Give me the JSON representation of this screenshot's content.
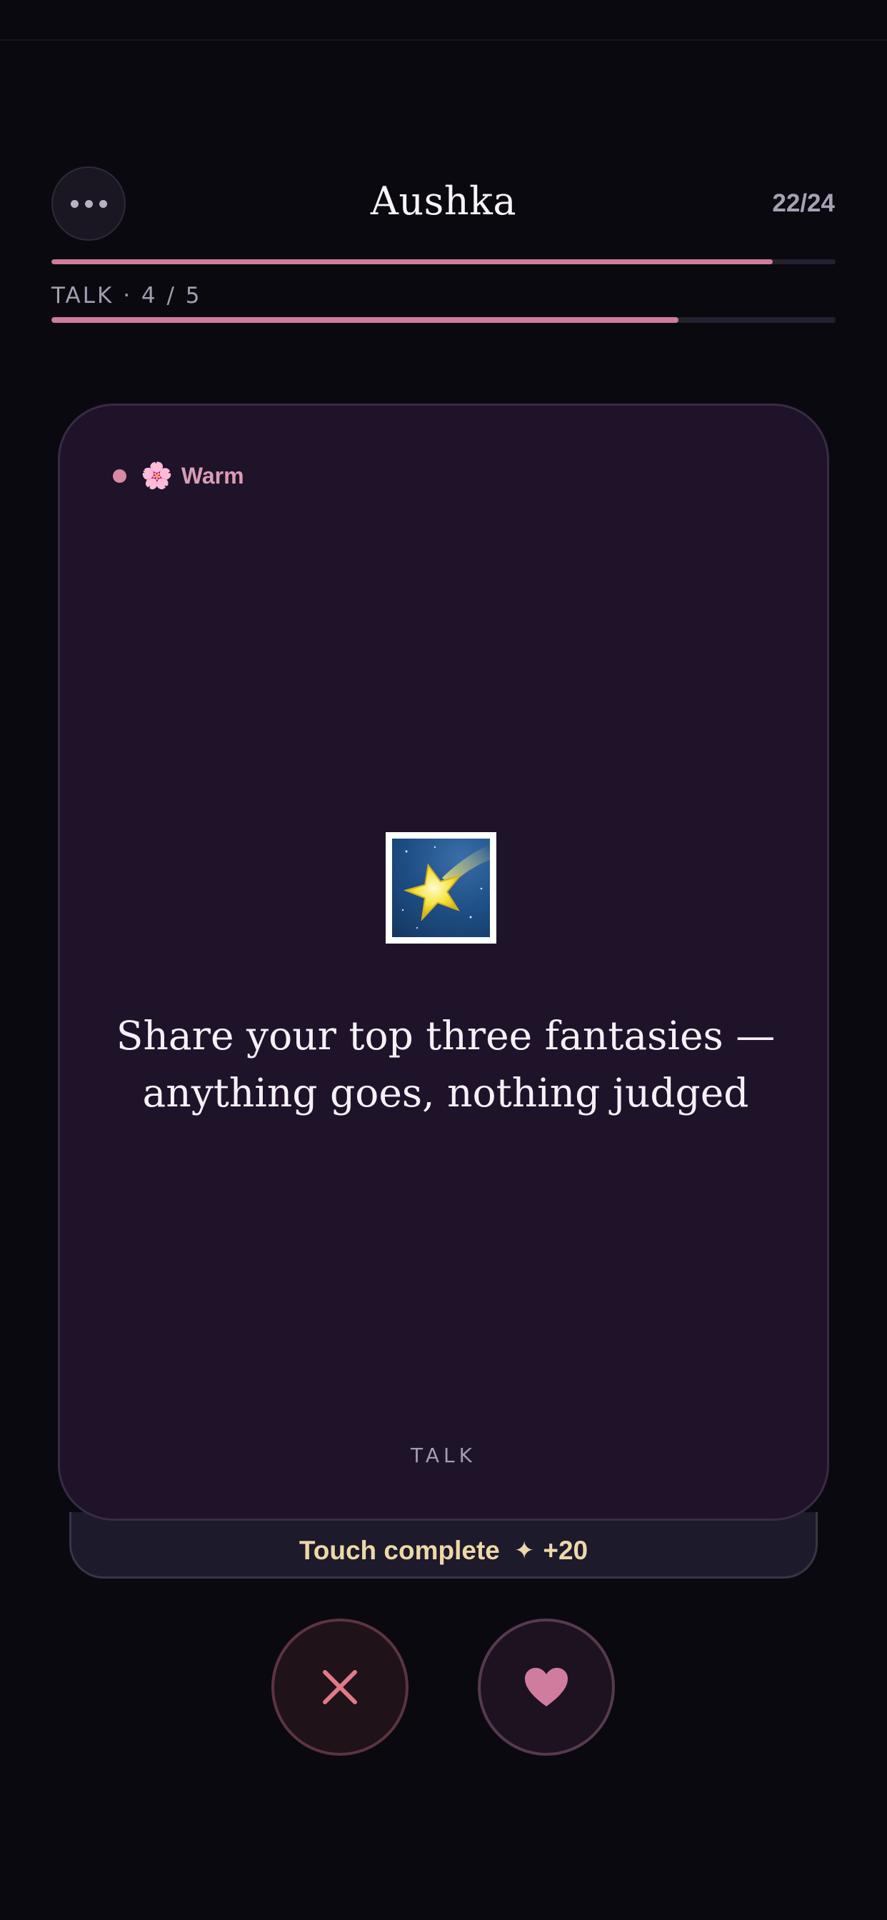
{
  "header": {
    "menu_icon": "more-horizontal-icon",
    "title": "Aushka",
    "counter": "22/24",
    "overall_progress": 0.92
  },
  "section": {
    "label": "TALK · 4 / 5",
    "progress": 0.8
  },
  "card": {
    "tag_icon": "cherry-blossom-icon",
    "tag_emoji": "🌸",
    "tag_label": "Warm",
    "image_icon": "shooting-star-icon",
    "prompt": "Share your top three fantasies — anything goes, nothing judged",
    "category": "TALK"
  },
  "status": {
    "text": "Touch complete",
    "sparkle": "✦",
    "points": "+20"
  },
  "actions": {
    "skip_icon": "close-icon",
    "like_icon": "heart-icon"
  },
  "colors": {
    "background": "#0b0910",
    "accent": "#cf7c9c",
    "card": "#1e1329",
    "reward": "#eed7a8"
  }
}
